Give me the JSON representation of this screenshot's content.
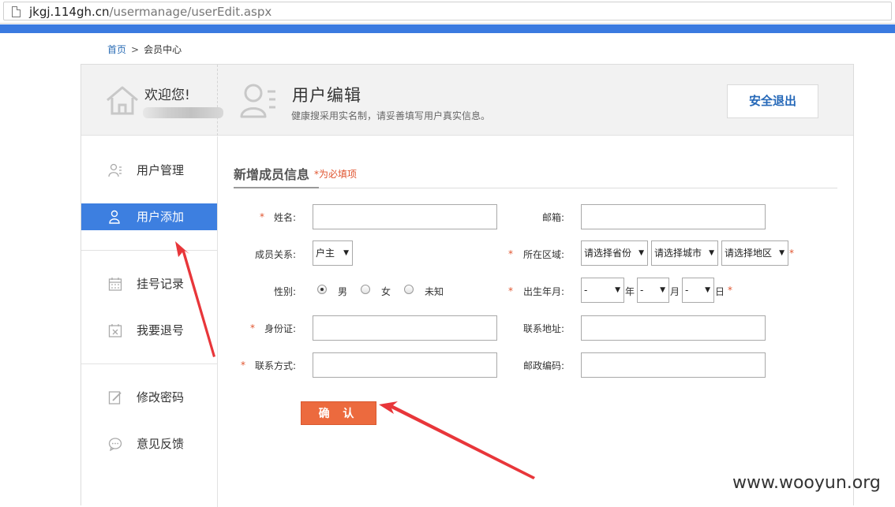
{
  "browser": {
    "url_host": "jkgj.114gh.cn",
    "url_path": "/usermanage/userEdit.aspx"
  },
  "breadcrumb": {
    "home": "首页",
    "separator": ">",
    "current": "会员中心"
  },
  "header": {
    "welcome": "欢迎您!",
    "title": "用户编辑",
    "subtitle": "健康搜采用实名制，请妥善填写用户真实信息。",
    "logout": "安全退出"
  },
  "sidebar": {
    "items": [
      {
        "label": "用户管理",
        "icon": "users-icon",
        "active": false
      },
      {
        "label": "用户添加",
        "icon": "user-add-icon",
        "active": true
      },
      {
        "label": "挂号记录",
        "icon": "calendar-icon",
        "active": false
      },
      {
        "label": "我要退号",
        "icon": "calendar-cancel-icon",
        "active": false
      },
      {
        "label": "修改密码",
        "icon": "edit-icon",
        "active": false
      },
      {
        "label": "意见反馈",
        "icon": "chat-icon",
        "active": false
      }
    ]
  },
  "form": {
    "section_title": "新增成员信息",
    "required_note": "*为必填项",
    "required_star": "*",
    "name_label": "姓名:",
    "email_label": "邮箱:",
    "relation_label": "成员关系:",
    "relation_value": "户主",
    "region_label": "所在区域:",
    "province_value": "请选择省份",
    "city_value": "请选择城市",
    "district_value": "请选择地区",
    "gender_label": "性别:",
    "gender_options": [
      "男",
      "女",
      "未知"
    ],
    "gender_selected": "男",
    "birth_label": "出生年月:",
    "year_value": "-",
    "month_value": "-",
    "day_value": "-",
    "year_unit": "年",
    "month_unit": "月",
    "day_unit": "日",
    "id_label": "身份证:",
    "address_label": "联系地址:",
    "phone_label": "联系方式:",
    "postcode_label": "邮政编码:",
    "submit": "确 认"
  },
  "watermark": "www.wooyun.org",
  "colors": {
    "active_nav": "#3d7fe0",
    "top_bar": "#3a7ae0",
    "submit_button": "#ec6a3e",
    "required": "#e0542f",
    "annotation_arrow": "#e8363a"
  }
}
